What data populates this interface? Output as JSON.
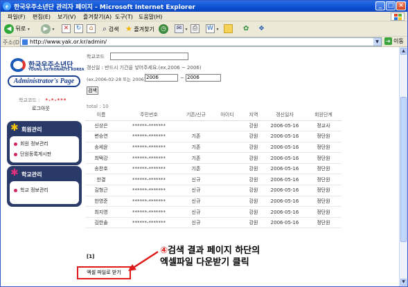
{
  "window": {
    "title": "한국우주소년단 관리자 페이지 - Microsoft Internet Explorer",
    "controls": [
      "_",
      "□",
      "×"
    ]
  },
  "menu": [
    "파일(F)",
    "편집(E)",
    "보기(V)",
    "즐겨찾기(A)",
    "도구(T)",
    "도움말(H)"
  ],
  "toolbar": {
    "back": "뒤로",
    "search": "검색",
    "favorites": "즐겨찾기"
  },
  "address": {
    "label": "주소(D)",
    "url": "http://www.yak.or.kr/admin/",
    "go": "이동"
  },
  "sidebar": {
    "logo_ko": "한국우주소년단",
    "logo_en": "YOUNG ASTRONAUTS KOREA",
    "admin_badge": "Administrator's Page",
    "school_code_label": "학교코드 :",
    "school_code_value": "*-*-***",
    "logout": "로그아웃",
    "members_panel": {
      "title": "회원관리",
      "items": [
        "회원 정보관리",
        "단원등록게시판"
      ]
    },
    "school_panel": {
      "title": "학교관리",
      "items": [
        "학교 정보관리"
      ]
    }
  },
  "form": {
    "school_code_label": "학교코드",
    "period_label": "갱신일 : 반드시 기간을 넣어주세요.(ex,2006 ~ 2006)",
    "period_hint": "(ex,2006-02-28 또는 2006)",
    "from_value": "2006",
    "to_value": "2006",
    "range_sep": "~",
    "search_button": "검색"
  },
  "results": {
    "total": "total : 10",
    "columns": [
      "이름",
      "주민번호",
      "기존/신규",
      "아이디",
      "지역",
      "갱신일자",
      "회원단계"
    ],
    "rows": [
      [
        "신상은",
        "******-*******",
        "",
        "",
        "강원",
        "2006-05-16",
        "정교사"
      ],
      [
        "변승연",
        "******-*******",
        "기존",
        "",
        "강원",
        "2006-05-16",
        "정단원"
      ],
      [
        "송세윤",
        "******-*******",
        "기존",
        "",
        "강원",
        "2006-05-16",
        "정단원"
      ],
      [
        "최택강",
        "******-*******",
        "기존",
        "",
        "강원",
        "2006-05-16",
        "정단원"
      ],
      [
        "송찬호",
        "******-*******",
        "기존",
        "",
        "강원",
        "2006-05-16",
        "정단원"
      ],
      [
        "한결",
        "******-*******",
        "신규",
        "",
        "강원",
        "2006-05-16",
        "정단원"
      ],
      [
        "김형근",
        "******-*******",
        "신규",
        "",
        "강원",
        "2006-05-16",
        "정단원"
      ],
      [
        "한영준",
        "******-*******",
        "신규",
        "",
        "강원",
        "2006-05-16",
        "정단원"
      ],
      [
        "최지영",
        "******-*******",
        "신규",
        "",
        "강원",
        "2006-05-16",
        "정단원"
      ],
      [
        "김한솔",
        "******-*******",
        "신규",
        "",
        "강원",
        "2006-05-16",
        "정단원"
      ]
    ],
    "pager": "[1]",
    "excel_link": "엑셀 파일로 받기"
  },
  "callout": {
    "number": "④",
    "line1": "검색 결과 페이지 하단의",
    "line2": "엑셀파일 다운받기 클릭"
  },
  "colors": {
    "highlight_red": "#e01818",
    "panel_navy": "#2a3a68",
    "title_blue": "#0b4fd0"
  }
}
